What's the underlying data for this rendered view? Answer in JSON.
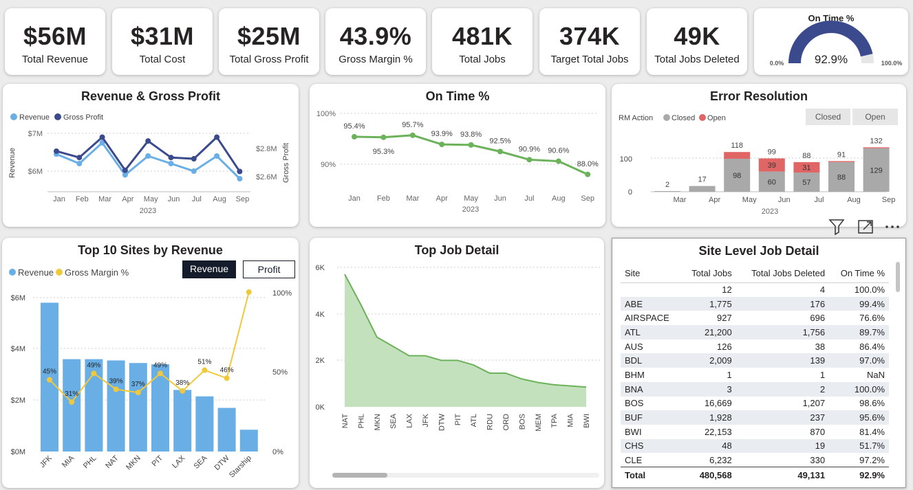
{
  "kpis": [
    {
      "value": "$56M",
      "label": "Total Revenue"
    },
    {
      "value": "$31M",
      "label": "Total Cost"
    },
    {
      "value": "$25M",
      "label": "Total Gross Profit"
    },
    {
      "value": "43.9%",
      "label": "Gross Margin %"
    },
    {
      "value": "481K",
      "label": "Total Jobs"
    },
    {
      "value": "374K",
      "label": "Target Total Jobs"
    },
    {
      "value": "49K",
      "label": "Total Jobs Deleted"
    }
  ],
  "gauge": {
    "title": "On Time %",
    "value": "92.9%",
    "fraction": 0.929,
    "min_label": "0.0%",
    "max_label": "100.0%",
    "color": "#3a4a8c"
  },
  "rev_gp": {
    "title": "Revenue & Gross Profit",
    "legend": [
      "Revenue",
      "Gross Profit"
    ],
    "ylabel_left": "Revenue",
    "ylabel_right": "Gross Profit",
    "left_ticks": [
      "$7M",
      "$6M"
    ],
    "right_ticks": [
      "$2.8M",
      "$2.6M"
    ],
    "months": [
      "Jan",
      "Feb",
      "Mar",
      "Apr",
      "May",
      "Jun",
      "Jul",
      "Aug",
      "Sep"
    ],
    "year": "2023",
    "colors": {
      "revenue": "#6aaee6",
      "gross_profit": "#3a4a8c"
    }
  },
  "ontime": {
    "title": "On Time %",
    "ticks": [
      "100%",
      "90%"
    ],
    "months": [
      "Jan",
      "Feb",
      "Mar",
      "Apr",
      "May",
      "Jun",
      "Jul",
      "Aug",
      "Sep"
    ],
    "labels": [
      "95.4%",
      "95.3%",
      "95.7%",
      "93.9%",
      "93.8%",
      "92.5%",
      "90.9%",
      "90.6%",
      "88.0%"
    ],
    "year": "2023",
    "color": "#6bb25a"
  },
  "error": {
    "title": "Error Resolution",
    "legend_title": "RM Action",
    "legend": [
      "Closed",
      "Open"
    ],
    "buttons": [
      "Closed",
      "Open"
    ],
    "months": [
      "Mar",
      "Apr",
      "May",
      "Jun",
      "Jul",
      "Aug",
      "Sep"
    ],
    "totals": [
      "2",
      "17",
      "118",
      "99",
      "88",
      "91",
      "132"
    ],
    "closed_labels": [
      "",
      "",
      "98",
      "60",
      "57",
      "88",
      "129"
    ],
    "open_labels": [
      "",
      "",
      "",
      "39",
      "31",
      "",
      ""
    ],
    "ticks": [
      "100",
      "0"
    ],
    "year": "2023",
    "colors": {
      "closed": "#a9a9a9",
      "open": "#e06666"
    }
  },
  "top_sites": {
    "title": "Top 10 Sites by Revenue",
    "legend": [
      "Revenue",
      "Gross Margin %"
    ],
    "toggle": [
      "Revenue",
      "Profit"
    ],
    "left_ticks": [
      "$6M",
      "$4M",
      "$2M",
      "$0M"
    ],
    "right_ticks": [
      "100%",
      "50%",
      "0%"
    ],
    "margin_labels": [
      "45%",
      "31%",
      "49%",
      "39%",
      "37%",
      "49%",
      "38%",
      "51%",
      "46%",
      ""
    ],
    "colors": {
      "revenue": "#6aaee6",
      "margin": "#f0c93a"
    }
  },
  "top_job": {
    "title": "Top Job Detail",
    "ticks": [
      "6K",
      "4K",
      "2K",
      "0K"
    ],
    "color": "#6bb25a"
  },
  "site_table": {
    "title": "Site Level Job Detail",
    "headers": [
      "Site",
      "Total Jobs",
      "Total Jobs Deleted",
      "On Time %"
    ],
    "rows": [
      [
        "",
        "12",
        "4",
        "100.0%"
      ],
      [
        "ABE",
        "1,775",
        "176",
        "99.4%"
      ],
      [
        "AIRSPACE",
        "927",
        "696",
        "76.6%"
      ],
      [
        "ATL",
        "21,200",
        "1,756",
        "89.7%"
      ],
      [
        "AUS",
        "126",
        "38",
        "86.4%"
      ],
      [
        "BDL",
        "2,009",
        "139",
        "97.0%"
      ],
      [
        "BHM",
        "1",
        "1",
        "NaN"
      ],
      [
        "BNA",
        "3",
        "2",
        "100.0%"
      ],
      [
        "BOS",
        "16,669",
        "1,207",
        "98.6%"
      ],
      [
        "BUF",
        "1,928",
        "237",
        "95.6%"
      ],
      [
        "BWI",
        "22,153",
        "870",
        "81.4%"
      ],
      [
        "CHS",
        "48",
        "19",
        "51.7%"
      ],
      [
        "CLE",
        "6,232",
        "330",
        "97.2%"
      ]
    ],
    "total": [
      "Total",
      "480,568",
      "49,131",
      "92.9%"
    ]
  },
  "chart_data": [
    {
      "type": "line",
      "title": "Revenue & Gross Profit",
      "categories": [
        "Jan",
        "Feb",
        "Mar",
        "Apr",
        "May",
        "Jun",
        "Jul",
        "Aug",
        "Sep"
      ],
      "series": [
        {
          "name": "Revenue",
          "axis": "left",
          "values": [
            6.45,
            6.2,
            6.75,
            5.9,
            6.4,
            6.2,
            6.0,
            6.4,
            5.8
          ]
        },
        {
          "name": "Gross Profit",
          "axis": "right",
          "values": [
            2.73,
            2.68,
            2.84,
            2.58,
            2.81,
            2.68,
            2.67,
            2.84,
            2.57
          ]
        }
      ],
      "ylim_left": [
        5.7,
        7.05
      ],
      "ylim_right": [
        2.55,
        2.9
      ],
      "ylabel": "Revenue",
      "y2label": "Gross Profit"
    },
    {
      "type": "line",
      "title": "On Time %",
      "categories": [
        "Jan",
        "Feb",
        "Mar",
        "Apr",
        "May",
        "Jun",
        "Jul",
        "Aug",
        "Sep"
      ],
      "values": [
        95.4,
        95.3,
        95.7,
        93.9,
        93.8,
        92.5,
        90.9,
        90.6,
        88.0
      ],
      "ylim": [
        86,
        100
      ]
    },
    {
      "type": "bar",
      "stacked": true,
      "title": "Error Resolution",
      "categories": [
        "Mar",
        "Apr",
        "May",
        "Jun",
        "Jul",
        "Aug",
        "Sep"
      ],
      "series": [
        {
          "name": "Closed",
          "values": [
            2,
            17,
            98,
            60,
            57,
            88,
            129
          ]
        },
        {
          "name": "Open",
          "values": [
            0,
            0,
            20,
            39,
            31,
            3,
            3
          ]
        }
      ],
      "ylim": [
        0,
        140
      ]
    },
    {
      "type": "bar",
      "title": "Top 10 Sites by Revenue",
      "categories": [
        "JFK",
        "MIA",
        "PHL",
        "NAT",
        "MKN",
        "PIT",
        "LAX",
        "SEA",
        "DTW",
        "Starship"
      ],
      "series": [
        {
          "name": "Revenue",
          "axis": "left",
          "values": [
            5.8,
            3.6,
            3.6,
            3.55,
            3.45,
            3.4,
            2.4,
            2.15,
            1.7,
            0.85
          ]
        },
        {
          "name": "Gross Margin %",
          "axis": "right",
          "type": "line",
          "values": [
            45,
            31,
            49,
            39,
            37,
            49,
            38,
            51,
            46,
            100
          ]
        }
      ],
      "ylim_left": [
        0,
        6.5
      ],
      "ylim_right": [
        0,
        115
      ]
    },
    {
      "type": "area",
      "title": "Top Job Detail",
      "categories": [
        "NAT",
        "PHL",
        "MKN",
        "SEA",
        "LAX",
        "JFK",
        "DTW",
        "PIT",
        "ATL",
        "RDU",
        "ORD",
        "BOS",
        "MEM",
        "TPA",
        "MIA",
        "BWI"
      ],
      "values": [
        5700,
        4400,
        3000,
        2600,
        2200,
        2200,
        2000,
        2000,
        1800,
        1450,
        1450,
        1200,
        1050,
        950,
        900,
        850
      ],
      "ylim": [
        0,
        6000
      ]
    }
  ]
}
